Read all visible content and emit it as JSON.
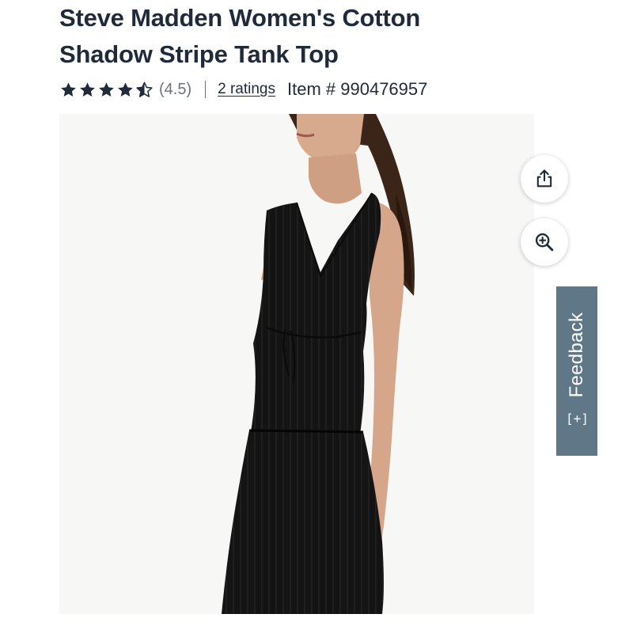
{
  "product": {
    "title_line1": "Steve Madden Women's Cotton",
    "title_line2": "Shadow Stripe Tank Top",
    "rating": 4.5,
    "rating_text": "(4.5)",
    "ratings_count_label": "2 ratings",
    "item_number": "Item # 990476957"
  },
  "actions": {
    "share_icon": "share-icon",
    "zoom_icon": "zoom-in-icon"
  },
  "feedback": {
    "label": "Feedback",
    "icon": "[+]"
  },
  "colors": {
    "text": "#1f2a3a",
    "muted": "#6b7280",
    "feedback_bg": "#5f7786",
    "star": "#1f2a3a"
  }
}
